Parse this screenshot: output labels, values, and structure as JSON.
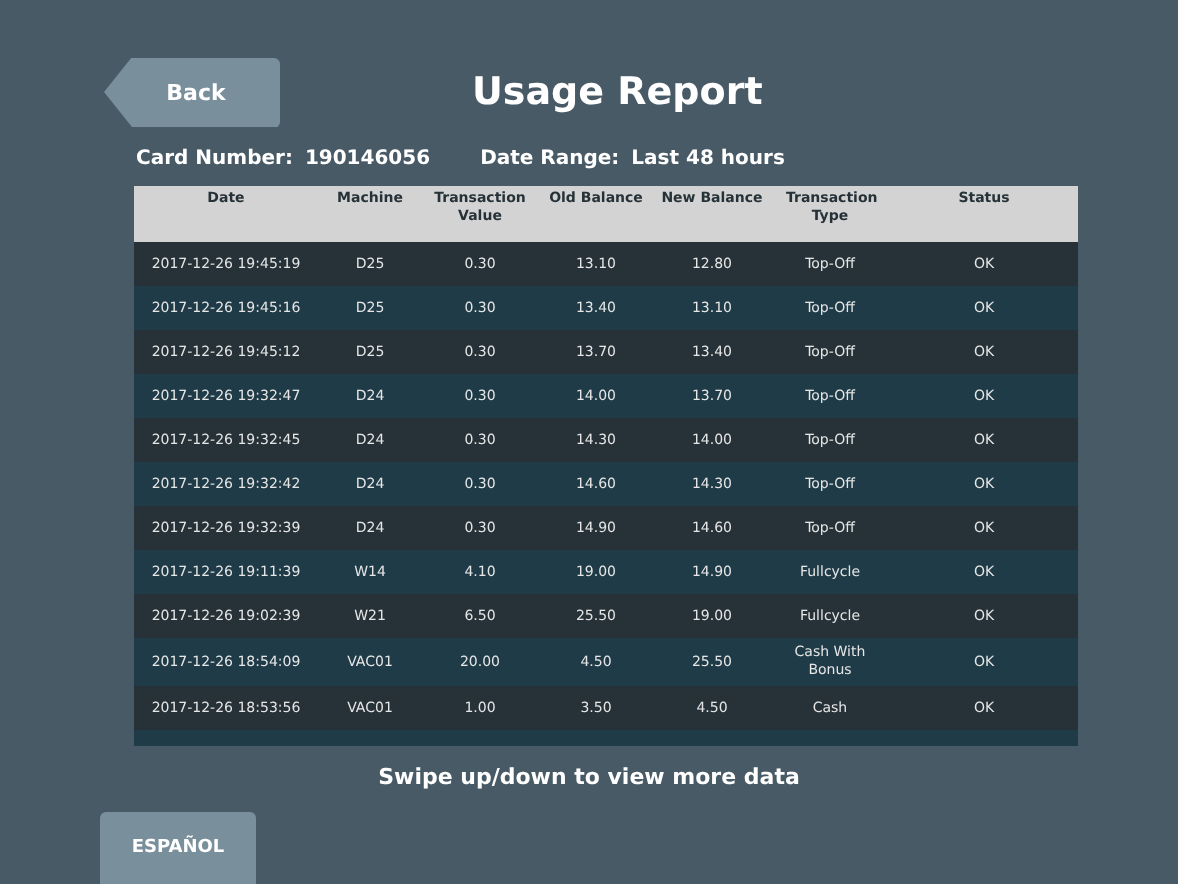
{
  "back_button": "Back",
  "title": "Usage Report",
  "card_number": {
    "label": "Card Number:",
    "value": "190146056"
  },
  "date_range": {
    "label": "Date Range:",
    "value": "Last 48 hours"
  },
  "table": {
    "columns": [
      "Date",
      "Machine",
      "Transaction Value",
      "Old Balance",
      "New Balance",
      "Transaction Type",
      "Status"
    ],
    "rows": [
      [
        "2017-12-26 19:45:19",
        "D25",
        "0.30",
        "13.10",
        "12.80",
        "Top-Off",
        "OK"
      ],
      [
        "2017-12-26 19:45:16",
        "D25",
        "0.30",
        "13.40",
        "13.10",
        "Top-Off",
        "OK"
      ],
      [
        "2017-12-26 19:45:12",
        "D25",
        "0.30",
        "13.70",
        "13.40",
        "Top-Off",
        "OK"
      ],
      [
        "2017-12-26 19:32:47",
        "D24",
        "0.30",
        "14.00",
        "13.70",
        "Top-Off",
        "OK"
      ],
      [
        "2017-12-26 19:32:45",
        "D24",
        "0.30",
        "14.30",
        "14.00",
        "Top-Off",
        "OK"
      ],
      [
        "2017-12-26 19:32:42",
        "D24",
        "0.30",
        "14.60",
        "14.30",
        "Top-Off",
        "OK"
      ],
      [
        "2017-12-26 19:32:39",
        "D24",
        "0.30",
        "14.90",
        "14.60",
        "Top-Off",
        "OK"
      ],
      [
        "2017-12-26 19:11:39",
        "W14",
        "4.10",
        "19.00",
        "14.90",
        "Fullcycle",
        "OK"
      ],
      [
        "2017-12-26 19:02:39",
        "W21",
        "6.50",
        "25.50",
        "19.00",
        "Fullcycle",
        "OK"
      ],
      [
        "2017-12-26 18:54:09",
        "VAC01",
        "20.00",
        "4.50",
        "25.50",
        "Cash With Bonus",
        "OK"
      ],
      [
        "2017-12-26 18:53:56",
        "VAC01",
        "1.00",
        "3.50",
        "4.50",
        "Cash",
        "OK"
      ]
    ]
  },
  "hint": "Swipe up/down to view more data",
  "language_button": "ESPAÑOL"
}
